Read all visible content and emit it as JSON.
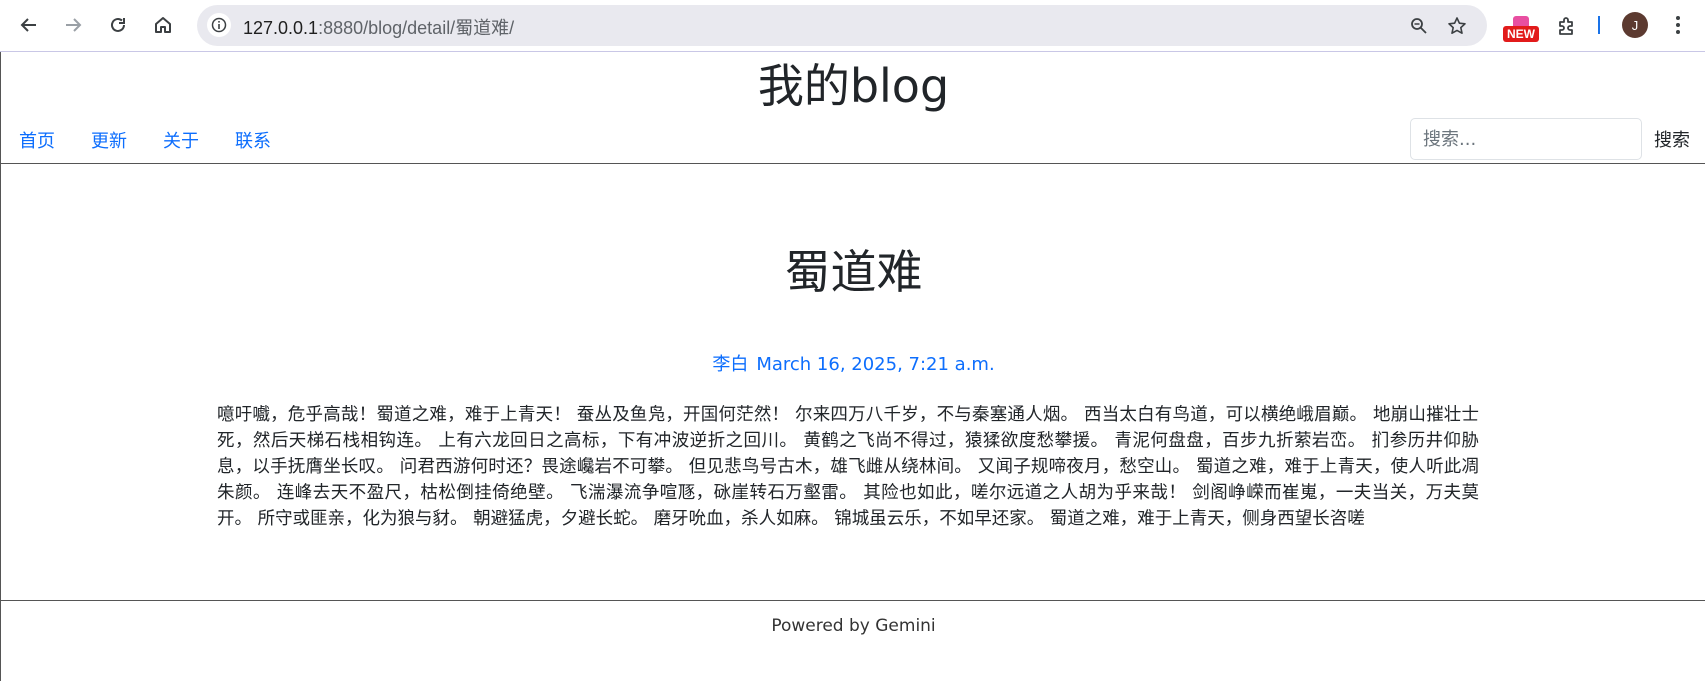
{
  "browser": {
    "url_host": "127.0.0.1",
    "url_rest": ":8880/blog/detail/蜀道难/",
    "new_badge": "NEW",
    "profile_initial": "J"
  },
  "site": {
    "title": "我的blog",
    "nav": [
      "首页",
      "更新",
      "关于",
      "联系"
    ],
    "search_placeholder": "搜索...",
    "search_button": "搜索"
  },
  "post": {
    "title": "蜀道难",
    "author": "李白",
    "date": "March 16, 2025, 7:21 a.m.",
    "body": "噫吁嚱，危乎高哉！蜀道之难，难于上青天！ 蚕丛及鱼凫，开国何茫然！ 尔来四万八千岁，不与秦塞通人烟。 西当太白有鸟道，可以横绝峨眉巅。 地崩山摧壮士死，然后天梯石栈相钩连。 上有六龙回日之高标，下有冲波逆折之回川。 黄鹤之飞尚不得过，猿猱欲度愁攀援。 青泥何盘盘，百步九折萦岩峦。 扪参历井仰胁息，以手抚膺坐长叹。 问君西游何时还？畏途巉岩不可攀。 但见悲鸟号古木，雄飞雌从绕林间。 又闻子规啼夜月，愁空山。 蜀道之难，难于上青天，使人听此凋朱颜。 连峰去天不盈尺，枯松倒挂倚绝壁。 飞湍瀑流争喧豗，砯崖转石万壑雷。 其险也如此，嗟尔远道之人胡为乎来哉！ 剑阁峥嵘而崔嵬，一夫当关，万夫莫开。 所守或匪亲，化为狼与豺。 朝避猛虎，夕避长蛇。 磨牙吮血，杀人如麻。 锦城虽云乐，不如早还家。 蜀道之难，难于上青天，侧身西望长咨嗟"
  },
  "footer": {
    "text": "Powered by Gemini"
  }
}
